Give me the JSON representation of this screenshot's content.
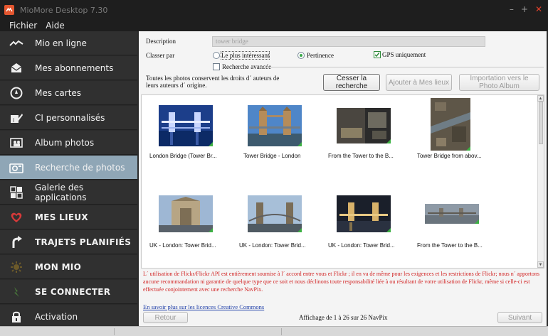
{
  "window": {
    "title": "MioMore Desktop 7.30",
    "minimize": "–",
    "maximize": "+",
    "close": "✕"
  },
  "menu": [
    "Fichier",
    "Aide"
  ],
  "sidebar": {
    "items": [
      {
        "label": "Mio en ligne",
        "icon": "signal-wave-icon"
      },
      {
        "label": "Mes abonnements",
        "icon": "envelope-icon"
      },
      {
        "label": "Mes cartes",
        "icon": "compass-icon"
      },
      {
        "label": "CI personnalisés",
        "icon": "pin-edit-icon"
      },
      {
        "label": "Album photos",
        "icon": "photo-album-icon"
      },
      {
        "label": "Recherche de photos",
        "icon": "camera-icon"
      },
      {
        "label": "Galerie des applications",
        "icon": "app-grid-icon"
      },
      {
        "label": "MES LIEUX",
        "icon": "heart-icon"
      },
      {
        "label": "TRAJETS PLANIFIÉS",
        "icon": "route-icon"
      },
      {
        "label": "MON MIO",
        "icon": "sun-gear-icon"
      },
      {
        "label": "SE CONNECTER",
        "icon": "connect-icon"
      },
      {
        "label": "Activation",
        "icon": "lock-icon"
      }
    ],
    "active_index": 5
  },
  "search": {
    "description_label": "Description",
    "description_value": "tower bridge",
    "sort_label": "Classer par",
    "sort_option_interesting": "Le plus intéressant",
    "sort_option_relevance": "Pertinence",
    "gps_only": "GPS uniquement",
    "advanced": "Recherche avancée",
    "rights_notice": "Toutes les photos conservent les droits d´ auteurs de leurs auteurs d´ origine.",
    "cancel_button": "Cesser la recherche",
    "add_button": "Ajouter à Mes lieux",
    "import_button": "Importation vers le Photo Album"
  },
  "photos": [
    {
      "caption": "London Bridge (Tower Br..."
    },
    {
      "caption": "Tower Bridge - London"
    },
    {
      "caption": "From the Tower to the B..."
    },
    {
      "caption": "Tower Bridge from abov..."
    },
    {
      "caption": "UK - London: Tower Brid..."
    },
    {
      "caption": "UK - London: Tower Brid..."
    },
    {
      "caption": "UK - London: Tower Brid..."
    },
    {
      "caption": "From the Tower to the B..."
    }
  ],
  "legal_text": "L´ utilisation de Flickr/Flickr API est entièrement soumise à l´ accord entre vous et Flickr ; il en va de même pour les exigences et les restrictions de Flickr; nous n´ apportons aucune recommandation ni garantie de quelque type que ce soit et nous déclinons toute responsabilité liée à ou résultant de votre utilisation de Flickr, même si celle-ci est effectuée conjointement avec une recherche NavPix.",
  "license_link": "En savoir plus sur les licences Creative Commons",
  "pagination": {
    "back": "Retour",
    "status": "Affichage de 1 à 26 sur 26 NavPix",
    "next": "Suivant"
  },
  "colors": {
    "accent_active": "#8fa6b6",
    "legal_red": "#d22424",
    "heart_red": "#d83a3a",
    "link_blue": "#1e3ea8"
  }
}
